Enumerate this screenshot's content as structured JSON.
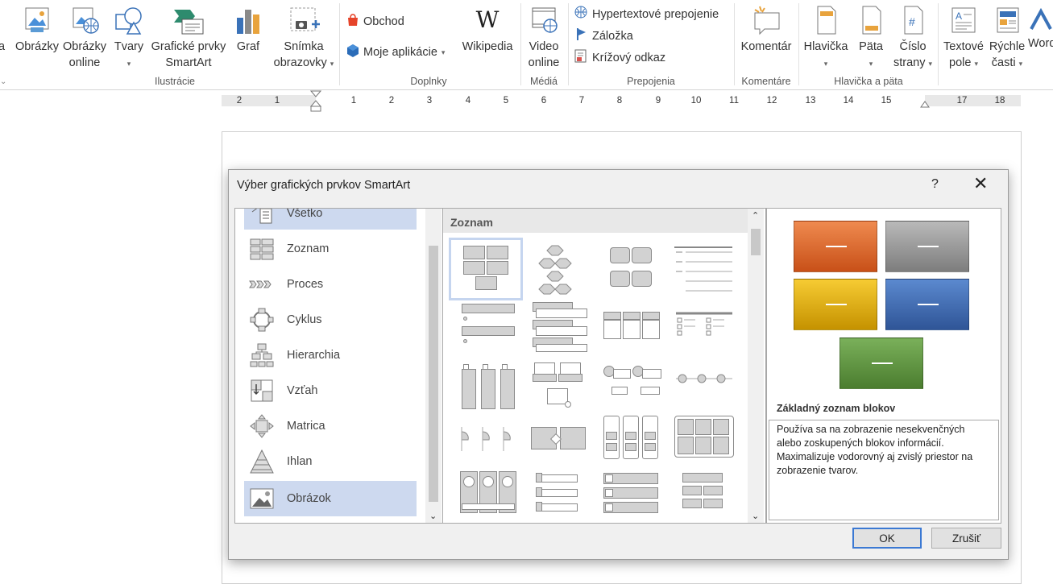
{
  "ribbon": {
    "groups": {
      "ilustracie": "Ilustrácie",
      "doplnky": "Doplnky",
      "media": "Médiá",
      "prepojenia": "Prepojenia",
      "komentare": "Komentáre",
      "hlavicka_pata": "Hlavička a päta"
    },
    "buttons": {
      "edge_a": "a",
      "obrazky": "Obrázky",
      "obrazky_online_1": "Obrázky",
      "obrazky_online_2": "online",
      "tvary": "Tvary",
      "smartart_1": "Grafické prvky",
      "smartart_2": "SmartArt",
      "graf": "Graf",
      "snimka_1": "Snímka",
      "snimka_2": "obrazovky",
      "obchod": "Obchod",
      "moje_aplikacie": "Moje aplikácie",
      "wikipedia": "Wikipedia",
      "video_1": "Video",
      "video_2": "online",
      "hypertext": "Hypertextové prepojenie",
      "zalozka": "Záložka",
      "krizovy": "Krížový odkaz",
      "komentar": "Komentár",
      "hlavicka": "Hlavička",
      "pata": "Päta",
      "cislo_1": "Číslo",
      "cislo_2": "strany",
      "textove_1": "Textové",
      "textove_2": "pole",
      "rychle_1": "Rýchle",
      "rychle_2": "časti",
      "word": "Word"
    }
  },
  "ruler": [
    "2",
    "1",
    "1",
    "2",
    "3",
    "4",
    "5",
    "6",
    "7",
    "8",
    "9",
    "10",
    "11",
    "12",
    "13",
    "14",
    "15",
    "17",
    "18"
  ],
  "dialog": {
    "title": "Výber grafických prvkov SmartArt",
    "help": "?",
    "close": "✕",
    "categories": [
      "Všetko",
      "Zoznam",
      "Proces",
      "Cyklus",
      "Hierarchia",
      "Vzťah",
      "Matrica",
      "Ihlan",
      "Obrázok"
    ],
    "gallery_header": "Zoznam",
    "preview_title": "Základný zoznam blokov",
    "preview_description": "Používa sa na zobrazenie nesekvenčných alebo zoskupených blokov informácií. Maximalizuje vodorovný aj zvislý priestor na zobrazenie tvarov.",
    "ok": "OK",
    "cancel": "Zrušiť"
  },
  "colors": {
    "accent_orange": "#d8662a",
    "accent_gray": "#9a9a9a",
    "accent_gold": "#e0a90f",
    "accent_blue": "#3a67b0",
    "accent_green": "#5e9440",
    "selection": "#cdd9ef"
  },
  "icons": [
    "pictures-icon",
    "online-pictures-icon",
    "shapes-icon",
    "smartart-icon",
    "chart-icon",
    "screenshot-icon",
    "store-icon",
    "my-addins-icon",
    "wikipedia-icon",
    "online-video-icon",
    "hyperlink-icon",
    "bookmark-icon",
    "cross-reference-icon",
    "comment-icon",
    "header-icon",
    "footer-icon",
    "page-number-icon",
    "text-box-icon",
    "quick-parts-icon",
    "wordart-icon"
  ]
}
